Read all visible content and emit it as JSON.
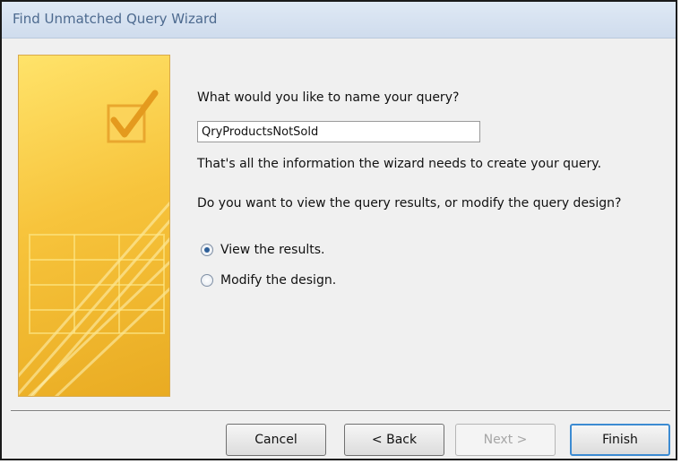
{
  "window": {
    "title": "Find Unmatched Query Wizard"
  },
  "form": {
    "prompt": "What would you like to name your query?",
    "query_name_value": "QryProductsNotSold",
    "info_text": "That's all the information the wizard needs to create your query.",
    "question": "Do you want to view the query results, or modify the query design?",
    "options": [
      {
        "label": "View the results.",
        "selected": true
      },
      {
        "label": "Modify the design.",
        "selected": false
      }
    ]
  },
  "buttons": {
    "cancel": "Cancel",
    "back": "< Back",
    "next": "Next >",
    "finish": "Finish"
  },
  "colors": {
    "accent": "#3c8bd2",
    "side_image": "#f7c43c"
  }
}
